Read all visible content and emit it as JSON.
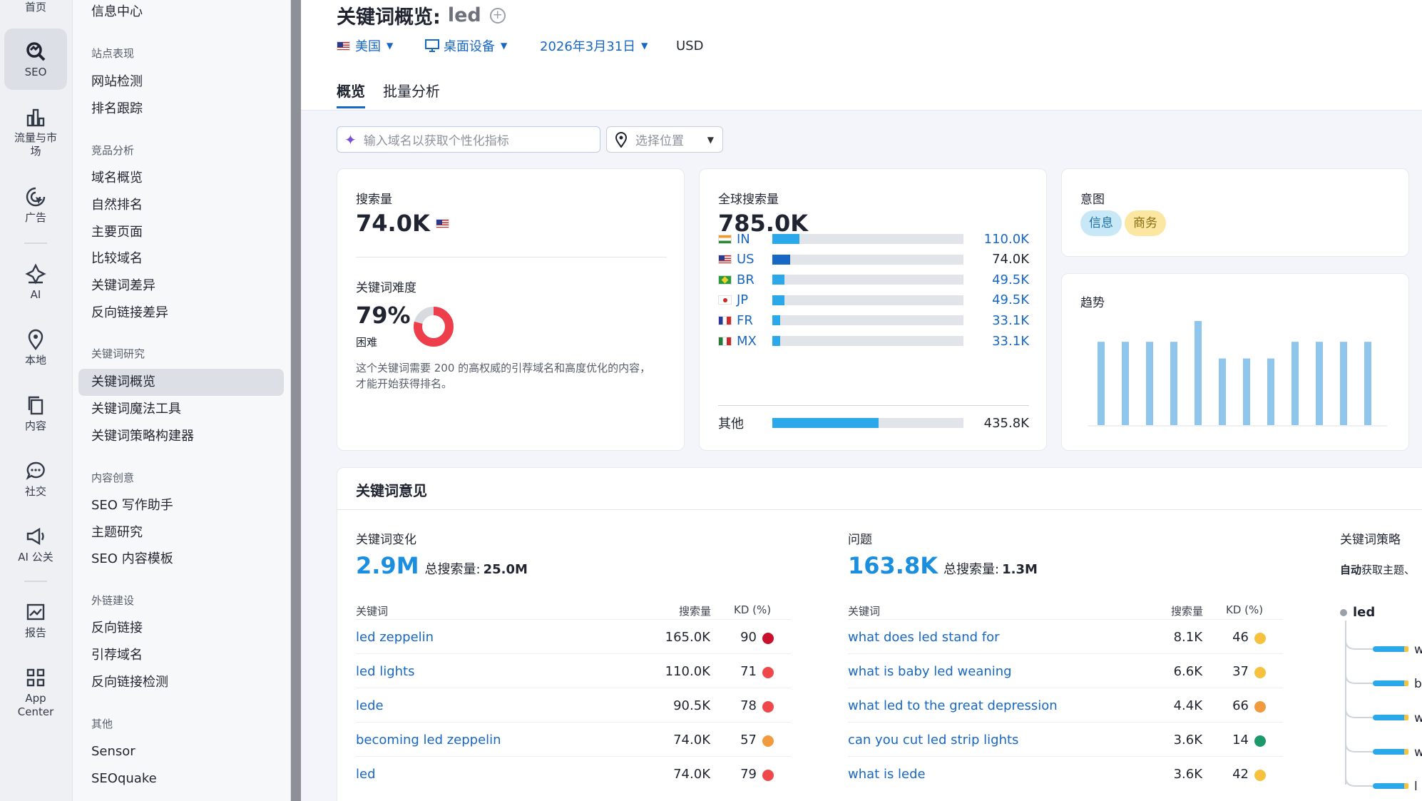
{
  "rail": {
    "home": "首页",
    "seo": "SEO",
    "traffic": "流量与市场",
    "ads": "广告",
    "ai": "AI",
    "local": "本地",
    "content": "内容",
    "social": "社交",
    "ai_pr": "AI 公关",
    "reports": "报告",
    "app_center": "App Center"
  },
  "subnav": {
    "info_center": "信息中心",
    "groups": {
      "site": "站点表现",
      "competitor": "竞品分析",
      "keyword_research": "关键词研究",
      "content_creation": "内容创意",
      "link_building": "外链建设",
      "other": "其他"
    },
    "items": {
      "site_audit": "网站检测",
      "rank_tracking": "排名跟踪",
      "domain_overview": "域名概览",
      "organic_rank": "自然排名",
      "top_pages": "主要页面",
      "compare_domains": "比较域名",
      "keyword_gap": "关键词差异",
      "backlink_gap": "反向链接差异",
      "keyword_overview": "关键词概览",
      "keyword_magic": "关键词魔法工具",
      "keyword_strategy": "关键词策略构建器",
      "seo_writing": "SEO 写作助手",
      "topic_research": "主题研究",
      "seo_templates": "SEO 内容模板",
      "backlinks": "反向链接",
      "referring_domains": "引荐域名",
      "backlink_audit": "反向链接检测",
      "sensor": "Sensor",
      "seoquake": "SEOquake"
    }
  },
  "header": {
    "title": "关键词概览:",
    "keyword": "led",
    "country": "美国",
    "device": "桌面设备",
    "date": "2026年3月31日",
    "currency": "USD",
    "tabs": [
      "概览",
      "批量分析"
    ],
    "search_placeholder": "输入域名以获取个性化指标",
    "location_placeholder": "选择位置"
  },
  "volume_card": {
    "label": "搜索量",
    "value": "74.0K",
    "difficulty_label": "关键词难度",
    "difficulty_value": "79%",
    "difficulty_percent": 79,
    "difficulty_level": "困难",
    "difficulty_desc": "这个关键词需要 200 的高权威的引荐域名和高度优化的内容，才能开始获得排名。"
  },
  "global_card": {
    "label": "全球搜索量",
    "value": "785.0K",
    "countries": [
      {
        "code": "IN",
        "flag": "in",
        "value": "110.0K",
        "fraction": 0.14,
        "color": "#2aa8ea",
        "link": true
      },
      {
        "code": "US",
        "flag": "us",
        "value": "74.0K",
        "fraction": 0.095,
        "color": "#1767c4",
        "link": false
      },
      {
        "code": "BR",
        "flag": "br",
        "value": "49.5K",
        "fraction": 0.063,
        "color": "#2aa8ea",
        "link": true
      },
      {
        "code": "JP",
        "flag": "jp",
        "value": "49.5K",
        "fraction": 0.063,
        "color": "#2aa8ea",
        "link": true
      },
      {
        "code": "FR",
        "flag": "fr",
        "value": "33.1K",
        "fraction": 0.042,
        "color": "#2aa8ea",
        "link": true
      },
      {
        "code": "MX",
        "flag": "mx",
        "value": "33.1K",
        "fraction": 0.042,
        "color": "#2aa8ea",
        "link": true
      }
    ],
    "other_label": "其他",
    "other_value": "435.8K",
    "other_fraction": 0.555
  },
  "intent_card": {
    "label": "意图",
    "pills": [
      {
        "text": "信息",
        "bg": "#c9e8f7",
        "fg": "#1a6fa8"
      },
      {
        "text": "商务",
        "bg": "#fbe6a2",
        "fg": "#8a6a10"
      }
    ]
  },
  "trend_card": {
    "label": "趋势",
    "bars": [
      0.8,
      0.8,
      0.8,
      0.8,
      1.0,
      0.64,
      0.64,
      0.64,
      0.8,
      0.8,
      0.8,
      0.8
    ]
  },
  "ideas": {
    "title": "关键词意见",
    "variations": {
      "label": "关键词变化",
      "count": "2.9M",
      "total_label": "总搜索量:",
      "total_value": "25.0M",
      "col_keyword": "关键词",
      "col_volume": "搜索量",
      "col_kd": "KD (%)",
      "rows": [
        {
          "keyword": "led zeppelin",
          "volume": "165.0K",
          "kd": "90",
          "color": "#c9102a"
        },
        {
          "keyword": "led lights",
          "volume": "110.0K",
          "kd": "71",
          "color": "#f0474a"
        },
        {
          "keyword": "lede",
          "volume": "90.5K",
          "kd": "78",
          "color": "#f0474a"
        },
        {
          "keyword": "becoming led zeppelin",
          "volume": "74.0K",
          "kd": "57",
          "color": "#f19a3e"
        },
        {
          "keyword": "led",
          "volume": "74.0K",
          "kd": "79",
          "color": "#f0474a"
        }
      ]
    },
    "questions": {
      "label": "问题",
      "count": "163.8K",
      "total_label": "总搜索量:",
      "total_value": "1.3M",
      "col_keyword": "关键词",
      "col_volume": "搜索量",
      "col_kd": "KD (%)",
      "rows": [
        {
          "keyword": "what does led stand for",
          "volume": "8.1K",
          "kd": "46",
          "color": "#f6c23e"
        },
        {
          "keyword": "what is baby led weaning",
          "volume": "6.6K",
          "kd": "37",
          "color": "#f6c23e"
        },
        {
          "keyword": "what led to the great depression",
          "volume": "4.4K",
          "kd": "66",
          "color": "#f19a3e"
        },
        {
          "keyword": "can you cut led strip lights",
          "volume": "3.6K",
          "kd": "14",
          "color": "#1a9a6a"
        },
        {
          "keyword": "what is lede",
          "volume": "3.6K",
          "kd": "42",
          "color": "#f6c23e"
        }
      ]
    },
    "strategy": {
      "label": "关键词策略",
      "desc_bold": "自动",
      "desc": "获取主题、",
      "root": "led",
      "branches": [
        "w",
        "b",
        "w",
        "w",
        "l"
      ]
    }
  }
}
